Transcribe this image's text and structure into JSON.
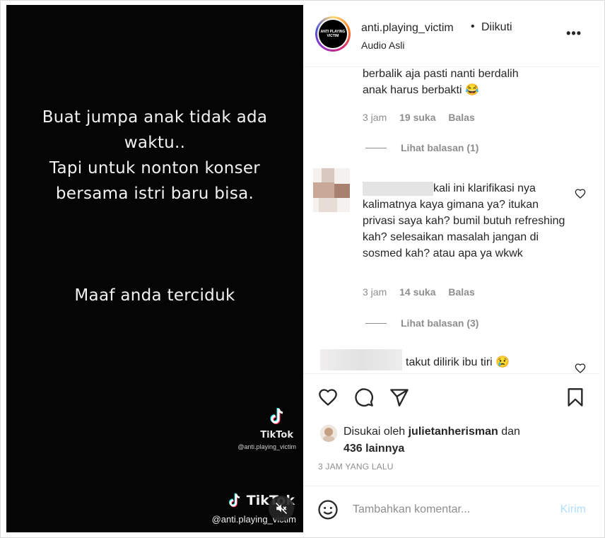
{
  "media": {
    "caption_lines": [
      "Buat jumpa anak tidak ada",
      "waktu..",
      "Tapi untuk nonton konser",
      "bersama istri baru bisa."
    ],
    "caption_bottom": "Maaf anda terciduk",
    "tiktok_name": "TikTok",
    "tiktok_handle_small": "@anti.playing_victim",
    "tiktok_name_bottom": "TikTok",
    "tiktok_handle_bottom": "@anti.playing_victim",
    "mute_icon": "speaker-muted-icon"
  },
  "header": {
    "avatar_text": "ANTI PLAYING VICTIM",
    "username": "anti.playing_victim",
    "dot": "•",
    "follow_status": "Diikuti",
    "subtitle": "Audio Asli",
    "more_icon": "•••"
  },
  "comments": [
    {
      "text": "berbalik aja pasti nanti berdalih anak harus berbakti 😂",
      "time": "3 jam",
      "likes": "19 suka",
      "reply": "Balas",
      "view_replies": "Lihat balasan (1)"
    },
    {
      "text": "kali ini klarifikasi nya kalimatnya kaya gimana ya? itukan privasi saya kah? bumil butuh refreshing kah? selesaikan masalah jangan di sosmed kah? atau apa ya wkwk",
      "time": "3 jam",
      "likes": "14 suka",
      "reply": "Balas",
      "view_replies": "Lihat balasan (3)"
    },
    {
      "text": "takut dilirik ibu tiri 😢"
    }
  ],
  "likes": {
    "prefix": "Disukai oleh",
    "user": "julietanherisman",
    "connector": "dan",
    "others": "436 lainnya"
  },
  "timestamp": "3 JAM YANG LALU",
  "add_comment": {
    "placeholder": "Tambahkan komentar...",
    "post_label": "Kirim"
  },
  "colors": {
    "post_disabled": "#b2dffc",
    "meta_gray": "#8e8e8e"
  }
}
